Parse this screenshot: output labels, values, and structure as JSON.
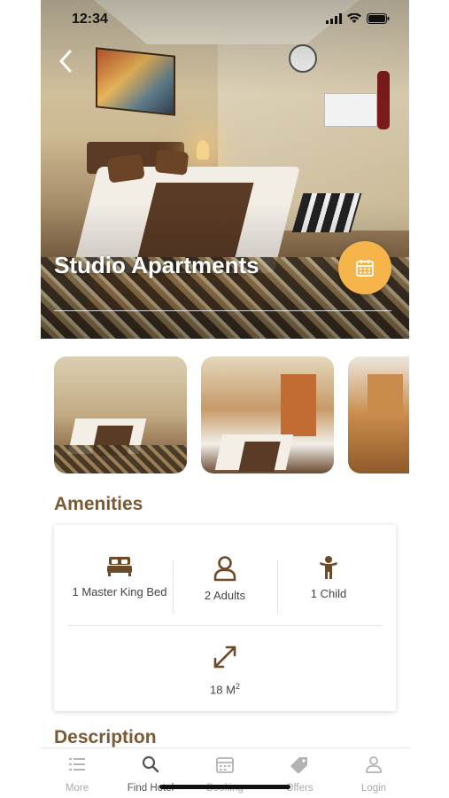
{
  "status_bar": {
    "time": "12:34"
  },
  "hero": {
    "title": "Studio Apartments"
  },
  "amenities": {
    "title": "Amenities",
    "items": [
      {
        "icon": "bed-icon",
        "label": "1 Master King Bed"
      },
      {
        "icon": "user-icon",
        "label": "2 Adults"
      },
      {
        "icon": "child-icon",
        "label": "1 Child"
      }
    ],
    "area": {
      "icon": "expand-icon",
      "value": "18 M",
      "unit_sup": "2"
    }
  },
  "description": {
    "title": "Description"
  },
  "bottom_nav": {
    "items": [
      {
        "label": "More",
        "icon": "menu-list-icon"
      },
      {
        "label": "Find Hotel",
        "icon": "search-icon",
        "active": true
      },
      {
        "label": "Booking",
        "icon": "calendar-icon"
      },
      {
        "label": "Offers",
        "icon": "tag-icon"
      },
      {
        "label": "Login",
        "icon": "person-icon"
      }
    ]
  },
  "colors": {
    "accent": "#f6b54b",
    "heading": "#7a5a35",
    "icon": "#6d4a28"
  }
}
